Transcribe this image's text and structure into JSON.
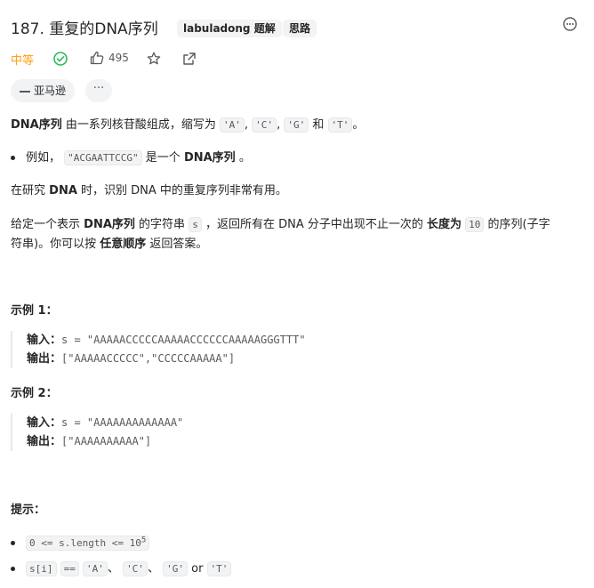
{
  "header": {
    "title": "187. 重复的DNA序列",
    "tags": [
      "labuladong 题解",
      "思路"
    ]
  },
  "meta": {
    "difficulty": "中等",
    "like_count": "495"
  },
  "company": {
    "label": "亚马逊"
  },
  "more_label": "···",
  "desc": {
    "p1_term": "DNA序列",
    "p1_text": "由一系列核苷酸组成，缩写为",
    "letters": [
      "'A'",
      "'C'",
      "'G'",
      "'T'"
    ],
    "comma": ",",
    "and": "和",
    "end": "。",
    "bullet_pre": "例如，",
    "bullet_code": "\"ACGAATTCCG\"",
    "bullet_mid": "是一个",
    "bullet_term": "DNA序列",
    "bullet_end": "。",
    "p2_pre": "在研究",
    "p2_term": "DNA",
    "p2_text": "时，识别 DNA 中的重复序列非常有用。",
    "p3_a": "给定一个表示",
    "p3_term": "DNA序列",
    "p3_b": "的字符串",
    "p3_code_s": "s",
    "p3_c": "，返回所有在 DNA 分子中出现不止一次的",
    "p3_term2": "长度为",
    "p3_code_10": "10",
    "p3_d": "的序列(子字",
    "p3_line2_a": "符串)。你可以按",
    "p3_term3": "任意顺序",
    "p3_line2_b": "返回答案。"
  },
  "examples": [
    {
      "title": "示例 1：",
      "input_label": "输入：",
      "input": "s = \"AAAAACCCCCAAAAACCCCCCAAAAAGGGTTT\"",
      "output_label": "输出：",
      "output": "[\"AAAAACCCCC\",\"CCCCCAAAAA\"]"
    },
    {
      "title": "示例 2：",
      "input_label": "输入：",
      "input": "s = \"AAAAAAAAAAAAA\"",
      "output_label": "输出：",
      "output": "[\"AAAAAAAAAA\"]"
    }
  ],
  "hints": {
    "title": "提示：",
    "h1_code": "0 <= s.length <= 10",
    "h1_sup": "5",
    "h2_code1": "s[i]",
    "h2_code2": "==",
    "h2_letters": [
      "'A'",
      "'C'",
      "'G'",
      "'T'"
    ],
    "h2_sep": "、",
    "h2_or": "or"
  },
  "colors": {
    "difficulty": "#ffa116",
    "solved": "#2cbb5d"
  },
  "icons": [
    "solved-check-icon",
    "thumbs-up-icon",
    "star-icon",
    "share-icon",
    "feedback-icon",
    "company-dash-icon"
  ]
}
